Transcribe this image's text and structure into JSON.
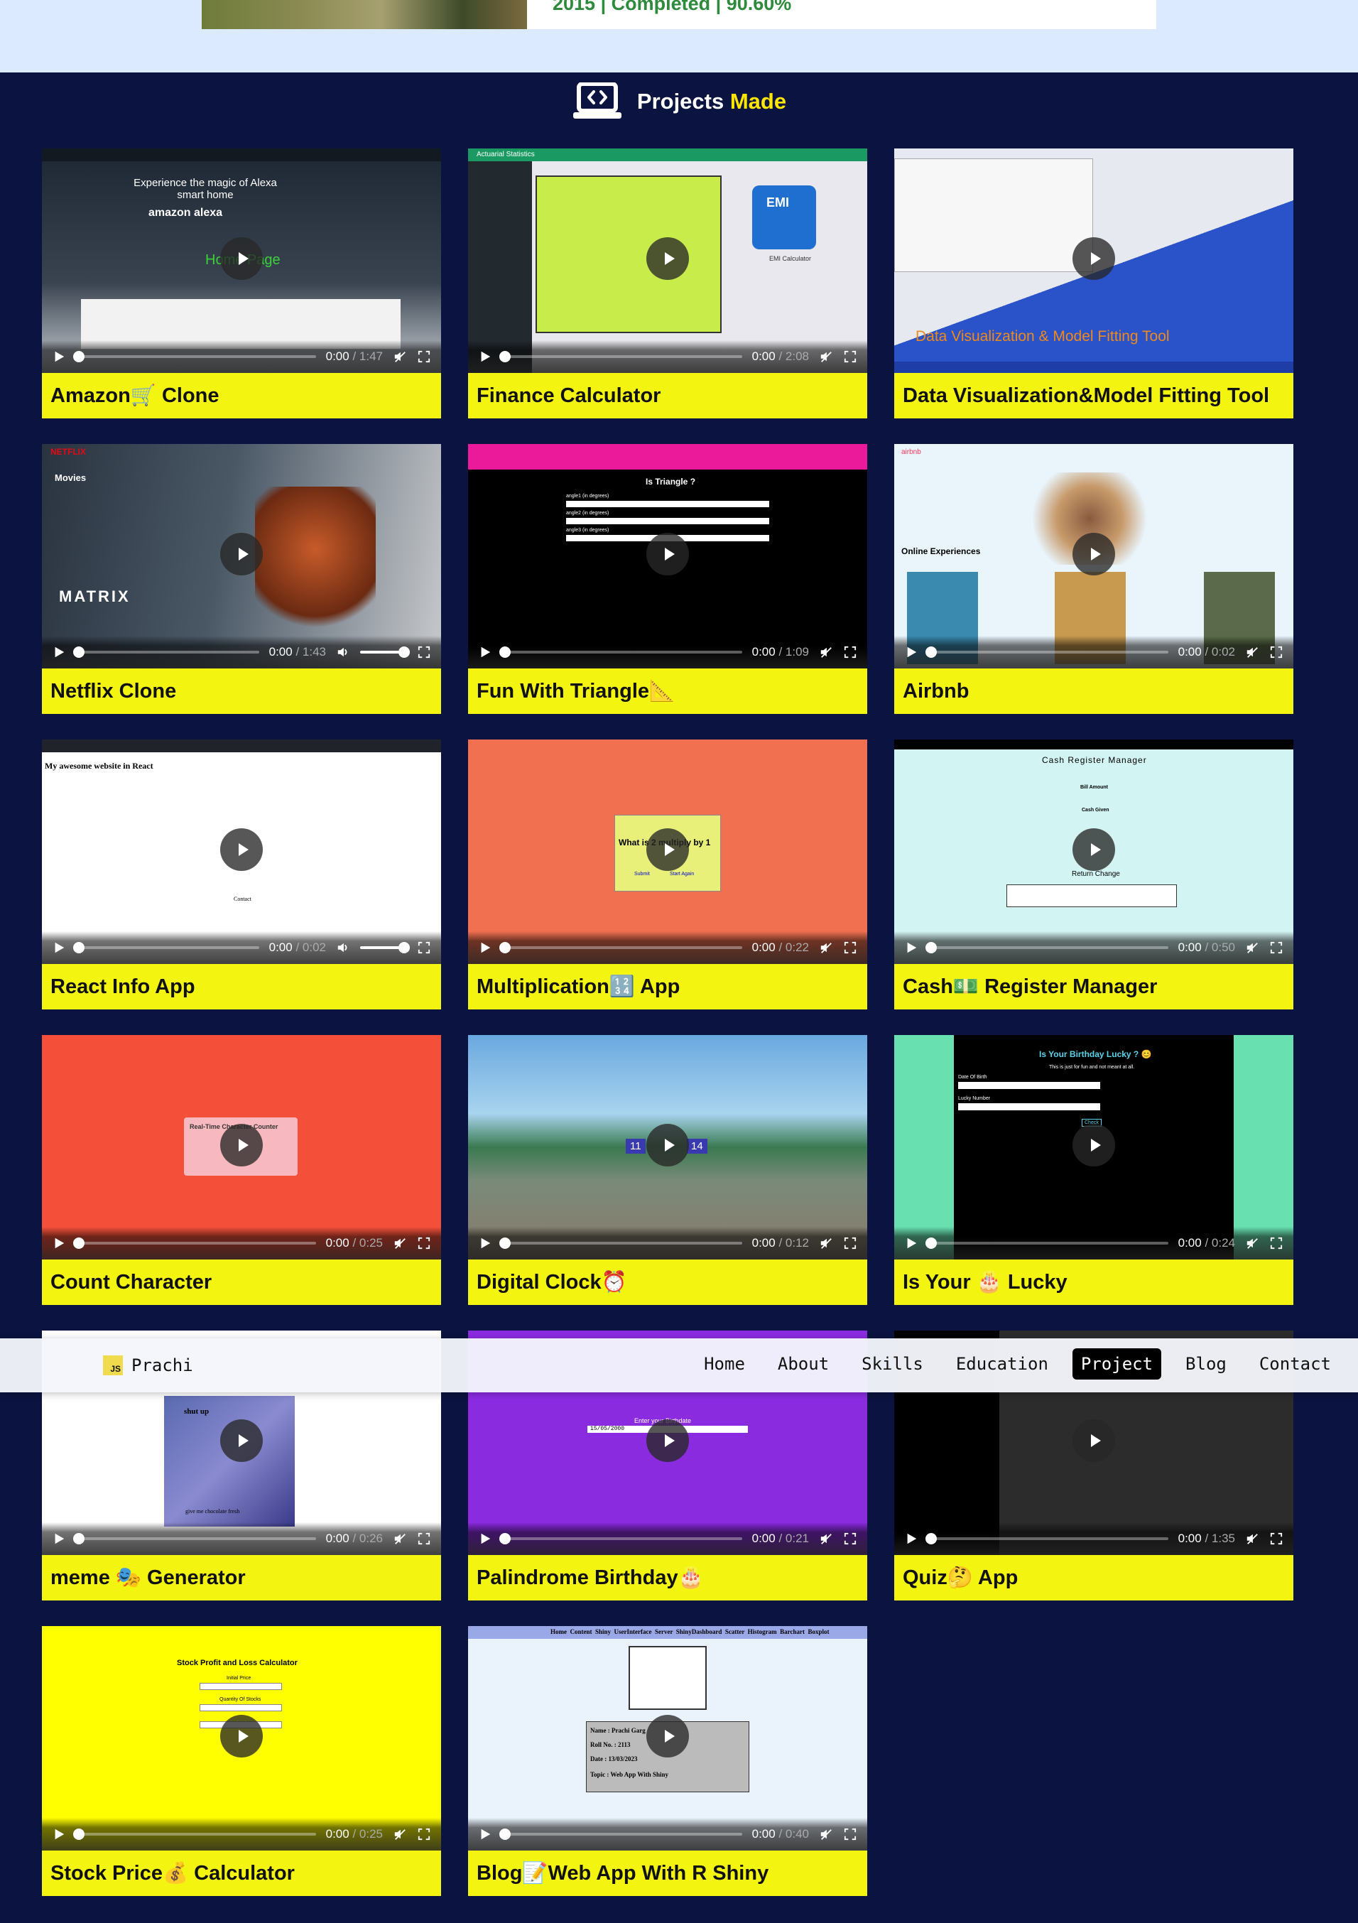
{
  "top_section": {
    "education_text": "2015 | Completed | 90.60%"
  },
  "section": {
    "title_main": "Projects",
    "title_highlight": "Made",
    "icon": "laptop-code-icon"
  },
  "navbar": {
    "brand_badge": "JS",
    "brand": "Prachi",
    "links": [
      "Home",
      "About",
      "Skills",
      "Education",
      "Project",
      "Blog",
      "Contact"
    ],
    "active": "Project"
  },
  "colors": {
    "page_bg": "#0b1440",
    "title_bar": "#f4f411",
    "highlight": "#ffe600"
  },
  "projects": [
    {
      "title": "Amazon🛒 Clone",
      "time": "0:00",
      "duration": "/ 1:47",
      "screenshot_text": [
        "Experience the magic of Alexa smart home",
        "amazon alexa",
        "Home Page"
      ]
    },
    {
      "title": "Finance Calculator",
      "time": "0:00",
      "duration": "/ 2:08",
      "screenshot_text": [
        "Actuarial Statistics",
        "EMI",
        "EMI Calculator"
      ]
    },
    {
      "title": "Data Visualization&Model Fitting Tool",
      "time": "",
      "duration": "",
      "screenshot_text": [
        "Data Visualization & Model Fitting Tool"
      ]
    },
    {
      "title": "Netflix Clone",
      "time": "0:00",
      "duration": "/ 1:43",
      "screenshot_text": [
        "NETFLIX",
        "Movies",
        "MATRIX"
      ]
    },
    {
      "title": "Fun With Triangle📐",
      "time": "0:00",
      "duration": "/ 1:09",
      "screenshot_text": [
        "Is Triangle ?",
        "angle1 (in degrees)",
        "angle2 (in degrees)",
        "angle3 (in degrees)"
      ]
    },
    {
      "title": "Airbnb",
      "time": "0:00",
      "duration": "/ 0:02",
      "screenshot_text": [
        "airbnb",
        "Online Experiences"
      ]
    },
    {
      "title": "React Info App",
      "time": "0:00",
      "duration": "/ 0:02",
      "screenshot_text": [
        "My awesome website in React",
        "Contact"
      ]
    },
    {
      "title": "Multiplication🔢 App",
      "time": "0:00",
      "duration": "/ 0:22",
      "screenshot_text": [
        "What is 2 multiply by 1",
        "Submit",
        "Start Again"
      ]
    },
    {
      "title": "Cash💵 Register Manager",
      "time": "0:00",
      "duration": "/ 0:50",
      "screenshot_text": [
        "Cash Register Manager",
        "Bill Amount",
        "Cash Given",
        "Return Change"
      ]
    },
    {
      "title": "Count Character",
      "time": "0:00",
      "duration": "/ 0:25",
      "screenshot_text": [
        "Real-Time Character Counter"
      ]
    },
    {
      "title": "Digital Clock⏰",
      "time": "0:00",
      "duration": "/ 0:12",
      "screenshot_text": [
        "11",
        "14"
      ]
    },
    {
      "title": "Is Your 🎂 Lucky",
      "time": "0:00",
      "duration": "/ 0:24",
      "screenshot_text": [
        "Is Your Birthday Lucky ? 😊",
        "This is just for fun and not meant at all.",
        "Date Of Birth",
        "Lucky Number",
        "Check"
      ]
    },
    {
      "title": "meme 🎭 Generator",
      "time": "0:00",
      "duration": "/ 0:26",
      "screenshot_text": [
        "shut up",
        "give me chocolate fresh"
      ]
    },
    {
      "title": "Palindrome Birthday🎂",
      "time": "0:00",
      "duration": "/ 0:21",
      "screenshot_text": [
        "Enter your Birthdate",
        "15/05/2000"
      ]
    },
    {
      "title": "Quiz🤔 App",
      "time": "0:00",
      "duration": "/ 1:35",
      "screenshot_text": []
    },
    {
      "title": "Stock Price💰 Calculator",
      "time": "0:00",
      "duration": "/ 0:25",
      "screenshot_text": [
        "Stock Profit and Loss Calculator",
        "Initial Price",
        "Quantity Of Stocks"
      ]
    },
    {
      "title": "Blog📝Web App With R Shiny",
      "time": "0:00",
      "duration": "/ 0:40",
      "screenshot_text": [
        "Home",
        "Content",
        "Shiny",
        "UserInterface",
        "Server",
        "ShinyDashboard",
        "Scatter",
        "Histogram",
        "Barchart",
        "Boxplot",
        "Name : Prachi Garg",
        "Roll No. : 2113",
        "Date : 13/03/2023",
        "Topic : Web App With Shiny"
      ]
    }
  ]
}
